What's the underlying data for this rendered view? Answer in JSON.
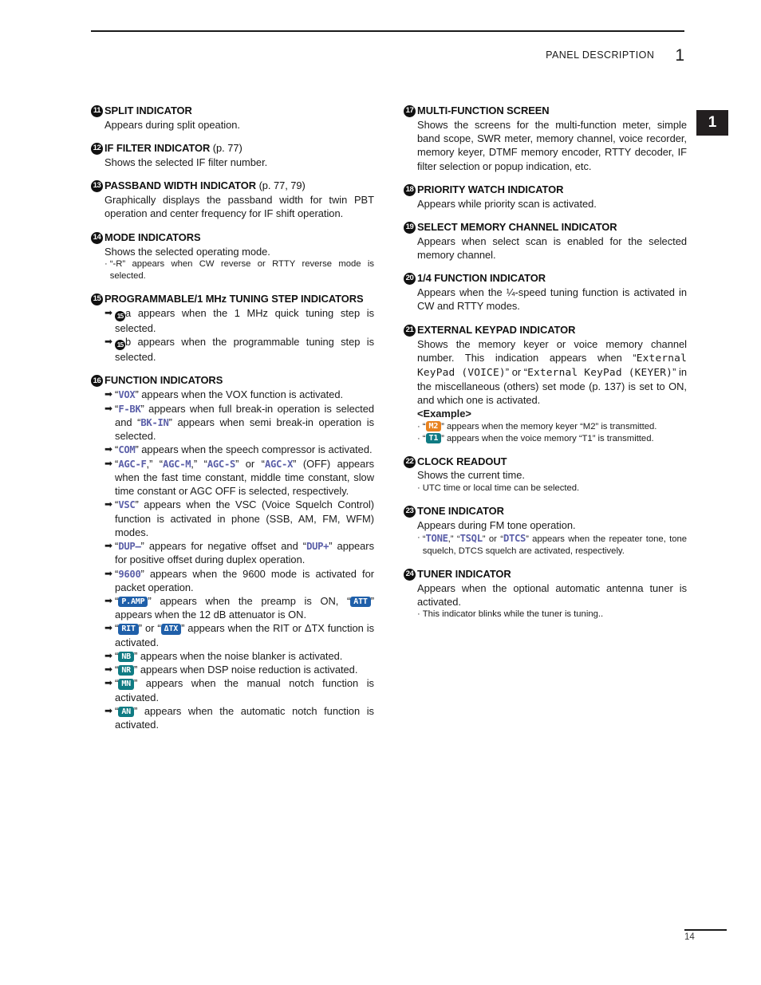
{
  "header": {
    "title": "PANEL DESCRIPTION",
    "chapter": "1"
  },
  "chapter_tab": "1",
  "footer": {
    "page_number": "14"
  },
  "glyphs": {
    "arrow": "➡",
    "dot": "·"
  },
  "left_column": {
    "blocks": [
      {
        "marker": "11",
        "title": "SPLIT INDICATOR",
        "body": "Appears during split opeation."
      },
      {
        "marker": "12",
        "title": "IF FILTER INDICATOR",
        "title_suffix": "(p. 77)",
        "body": "Shows the selected IF filter number."
      },
      {
        "marker": "13",
        "title": "PASSBAND WIDTH INDICATOR",
        "title_suffix": "(p. 77, 79)",
        "body": "Graphically displays the passband width for twin PBT operation and center frequency for IF shift operation."
      },
      {
        "marker": "14",
        "title": "MODE INDICATORS",
        "body": "Shows the selected operating mode.",
        "note": "“-R” appears when CW reverse or RTTY reverse mode is selected."
      },
      {
        "marker": "15",
        "title": "PROGRAMMABLE/1 MHz TUNING STEP INDICATORS",
        "arrows": [
          {
            "pre": "",
            "inline_marker": "15",
            "post_marker": "a appears when the 1 MHz quick tuning step is selected."
          },
          {
            "pre": "",
            "inline_marker": "15",
            "post_marker": "b appears when the programmable tuning step is selected."
          }
        ]
      },
      {
        "marker": "16",
        "title": "FUNCTION INDICATORS",
        "items": [
          {
            "segments": [
              {
                "t": "“"
              },
              {
                "lcd": "VOX"
              },
              {
                "t": "” appears when the VOX function is activated."
              }
            ]
          },
          {
            "segments": [
              {
                "t": "“"
              },
              {
                "lcd": "F-BK"
              },
              {
                "t": "” appears when full break-in operation is selected and “"
              },
              {
                "lcd": "BK-IN"
              },
              {
                "t": "” appears when semi break-in operation is selected."
              }
            ]
          },
          {
            "segments": [
              {
                "t": "“"
              },
              {
                "lcd": "COM"
              },
              {
                "t": "” appears when the speech compressor is activated."
              }
            ]
          },
          {
            "segments": [
              {
                "t": "“"
              },
              {
                "lcd": "AGC-F"
              },
              {
                "t": ",” “"
              },
              {
                "lcd": "AGC-M"
              },
              {
                "t": ",” “"
              },
              {
                "lcd": "AGC-S"
              },
              {
                "t": "” or “"
              },
              {
                "lcd": "AGC-X"
              },
              {
                "t": "” (OFF) appears when the fast time constant, middle time constant, slow time constant or AGC OFF is selected, respectively."
              }
            ]
          },
          {
            "segments": [
              {
                "t": "“"
              },
              {
                "lcd": "VSC"
              },
              {
                "t": "” appears when the VSC (Voice Squelch Control) function is activated in phone (SSB, AM, FM, WFM) modes."
              }
            ]
          },
          {
            "segments": [
              {
                "t": "“"
              },
              {
                "lcd": "DUP–"
              },
              {
                "t": "” appears for negative offset and “"
              },
              {
                "lcd": "DUP+"
              },
              {
                "t": "” appears for positive offset during duplex operation."
              }
            ]
          },
          {
            "segments": [
              {
                "t": "“"
              },
              {
                "lcd": "9600"
              },
              {
                "t": "” appears when the 9600 mode is activated for packet operation."
              }
            ]
          },
          {
            "segments": [
              {
                "t": "“"
              },
              {
                "badge": "P.AMP",
                "color": "blue"
              },
              {
                "t": "” appears when the preamp is ON, “"
              },
              {
                "badge": "ATT",
                "color": "blue"
              },
              {
                "t": "” appears when the 12 dB attenuator is ON."
              }
            ]
          },
          {
            "segments": [
              {
                "t": "“"
              },
              {
                "badge": "RIT",
                "color": "blue"
              },
              {
                "t": "” or “"
              },
              {
                "badge": "ΔTX",
                "color": "blue"
              },
              {
                "t": "” appears when the RIT or ΔTX function is activated."
              }
            ]
          },
          {
            "segments": [
              {
                "t": "“"
              },
              {
                "badge": "NB",
                "color": "teal"
              },
              {
                "t": "” appears when the noise blanker is activated."
              }
            ]
          },
          {
            "segments": [
              {
                "t": "“"
              },
              {
                "badge": "NR",
                "color": "teal"
              },
              {
                "t": "” appears when DSP noise reduction is activated."
              }
            ]
          },
          {
            "segments": [
              {
                "t": "“"
              },
              {
                "badge": "MN",
                "color": "teal"
              },
              {
                "t": "” appears when the manual notch function is activated."
              }
            ]
          },
          {
            "segments": [
              {
                "t": "“"
              },
              {
                "badge": "AN",
                "color": "teal"
              },
              {
                "t": "” appears when the automatic notch function is activated."
              }
            ]
          }
        ]
      }
    ]
  },
  "right_column": {
    "blocks": [
      {
        "marker": "17",
        "title": "MULTI-FUNCTION SCREEN",
        "body": "Shows the screens for the multi-function meter, simple band scope, SWR meter, memory channel, voice recorder, memory keyer, DTMF memory encoder, RTTY decoder, IF filter selection or popup indication, etc."
      },
      {
        "marker": "18",
        "title": "PRIORITY WATCH INDICATOR",
        "body": "Appears while priority scan is activated."
      },
      {
        "marker": "19",
        "title": "SELECT MEMORY CHANNEL INDICATOR",
        "body": "Appears when select scan is enabled for the selected memory channel."
      },
      {
        "marker": "20",
        "title": "1/4 FUNCTION INDICATOR",
        "body": "Appears when the ¼-speed tuning function is activated in CW and RTTY modes."
      },
      {
        "marker": "21",
        "title": "EXTERNAL KEYPAD INDICATOR",
        "body_segments": [
          {
            "t": "Shows the memory keyer or voice memory channel number. This indication appears when “"
          },
          {
            "lcd_dark": "External KeyPad (VOICE)"
          },
          {
            "t": "” or “"
          },
          {
            "lcd_dark": "External KeyPad (KEYER)"
          },
          {
            "t": "” in the miscellaneous (others) set mode (p. 137) is set to ON, and which one is activated."
          }
        ],
        "example_label": "<Example>",
        "examples": [
          {
            "segments": [
              {
                "t": "“"
              },
              {
                "badge": "M2",
                "color": "orange"
              },
              {
                "t": "” appears when the memory keyer “M2” is transmitted."
              }
            ]
          },
          {
            "segments": [
              {
                "t": "“"
              },
              {
                "badge": "T1",
                "color": "teal"
              },
              {
                "t": "” appears when the voice memory “T1” is transmitted."
              }
            ]
          }
        ]
      },
      {
        "marker": "22",
        "title": "CLOCK READOUT",
        "body": "Shows the current time.",
        "note": "UTC time or local time can be selected."
      },
      {
        "marker": "23",
        "title": "TONE INDICATOR",
        "body": "Appears during FM tone operation.",
        "note_segments": [
          {
            "t": "“"
          },
          {
            "lcd": "TONE"
          },
          {
            "t": ",” “"
          },
          {
            "lcd": "TSQL"
          },
          {
            "t": "” or “"
          },
          {
            "lcd": "DTCS"
          },
          {
            "t": "” appears when the repeater tone, tone squelch, DTCS squelch are activated, respectively."
          }
        ]
      },
      {
        "marker": "24",
        "title": "TUNER INDICATOR",
        "body": "Appears when the optional automatic antenna tuner is activated.",
        "note": "This indicator blinks while the tuner is tuning.."
      }
    ]
  }
}
